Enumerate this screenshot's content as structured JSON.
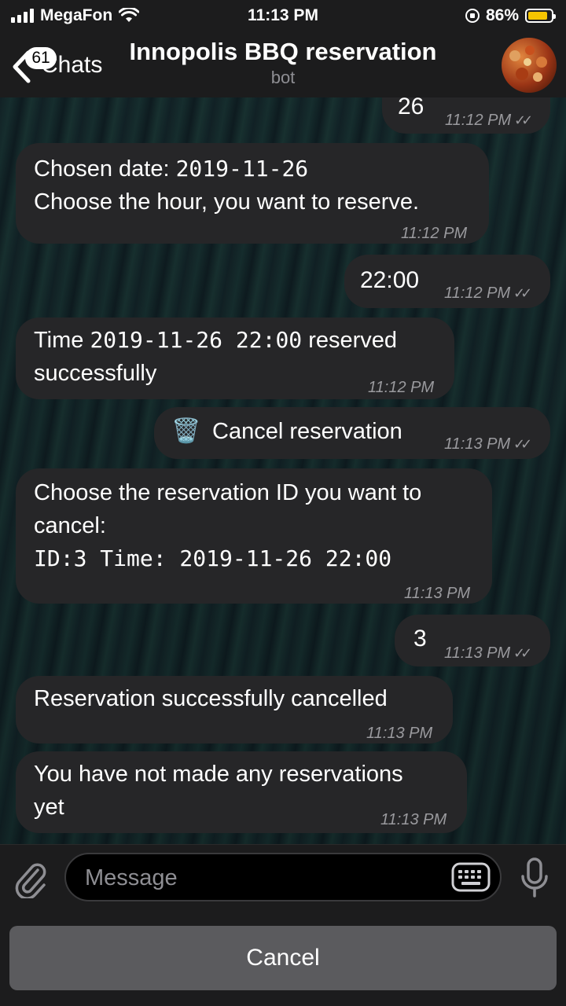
{
  "status_bar": {
    "carrier": "MegaFon",
    "time": "11:13 PM",
    "battery_percent": "86%",
    "battery_level": 0.86,
    "icons": [
      "signal-bars-icon",
      "wifi-icon",
      "orientation-lock-icon",
      "battery-icon"
    ]
  },
  "header": {
    "back_label": "Chats",
    "unread_badge": "61",
    "title": "Innopolis BBQ reservation",
    "subtitle": "bot"
  },
  "messages": [
    {
      "direction": "out",
      "text": "26",
      "time": "11:12 PM",
      "read": true
    },
    {
      "direction": "in",
      "lines": [
        "Chosen date: ",
        "2019-11-26",
        "Choose the hour, you want to reserve."
      ],
      "time": "11:12 PM"
    },
    {
      "direction": "out",
      "text": "22:00",
      "time": "11:12 PM",
      "read": true
    },
    {
      "direction": "in",
      "lines": [
        "Time ",
        "2019-11-26 22:00",
        " reserved",
        "successfully"
      ],
      "time": "11:12 PM"
    },
    {
      "direction": "out",
      "emoji": "🗑️",
      "text": "Cancel reservation",
      "time": "11:13 PM",
      "read": true
    },
    {
      "direction": "in",
      "lines": [
        "Choose the reservation ID you want to",
        "cancel:",
        "ID:3 Time: 2019-11-26 22:00"
      ],
      "time": "11:13 PM"
    },
    {
      "direction": "out",
      "text": "3",
      "time": "11:13 PM",
      "read": true
    },
    {
      "direction": "in",
      "lines": [
        "Reservation successfully cancelled"
      ],
      "time": "11:13 PM"
    },
    {
      "direction": "in",
      "lines": [
        "You have not made any reservations",
        "yet"
      ],
      "time": "11:13 PM"
    }
  ],
  "input": {
    "placeholder": "Message"
  },
  "reply_keyboard": {
    "buttons": [
      "Cancel"
    ]
  },
  "colors": {
    "bubble": "#262628",
    "bar": "#1c1c1d",
    "keyboard_button": "#5b5b5e",
    "battery": "#f5c400"
  }
}
